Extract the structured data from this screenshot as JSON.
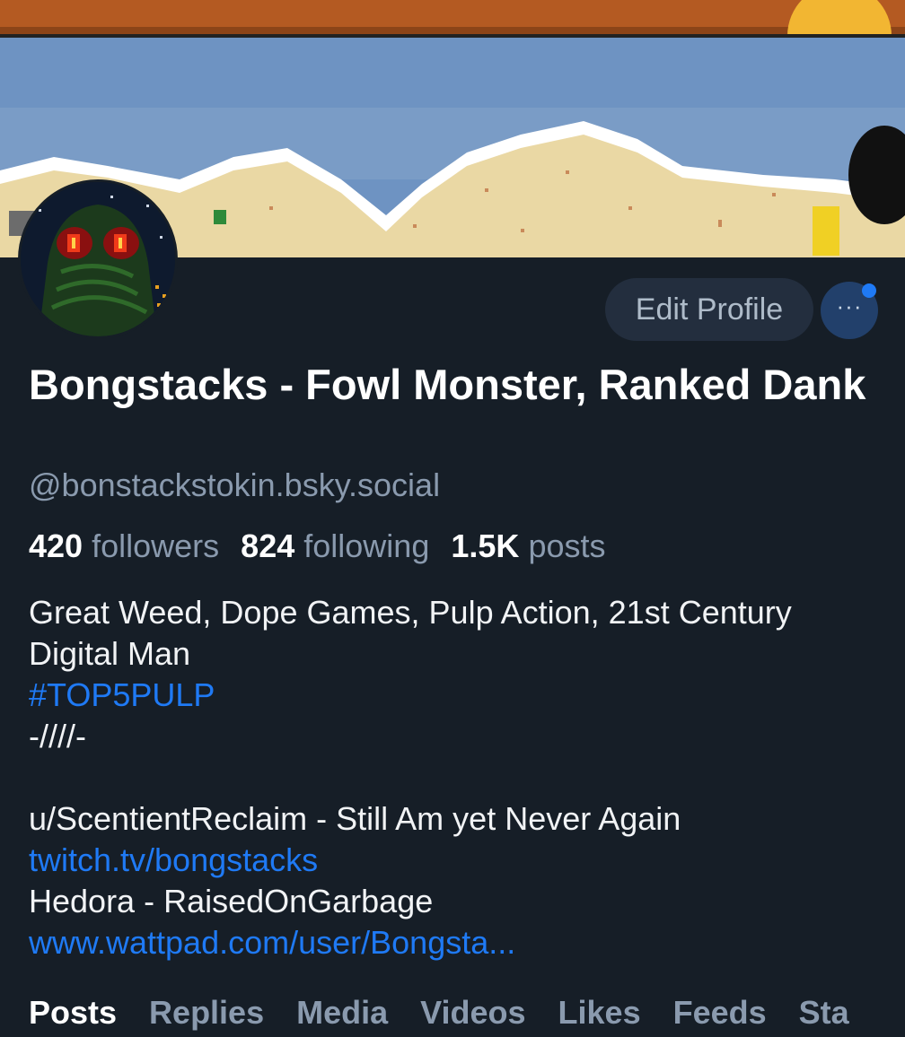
{
  "profile": {
    "display_name": "Bongstacks - Fowl Monster, Ranked Dank",
    "handle": "@bonstackstokin.bsky.social"
  },
  "actions": {
    "edit_profile_label": "Edit Profile",
    "more_label": "···"
  },
  "stats": {
    "followers_count": "420",
    "followers_label": "followers",
    "following_count": "824",
    "following_label": "following",
    "posts_count": "1.5K",
    "posts_label": "posts"
  },
  "bio": {
    "line1": "Great Weed, Dope Games, Pulp Action, 21st Century",
    "line2": "Digital Man",
    "hashtag": "#TOP5PULP",
    "line4": "-////-",
    "line6": "u/ScentientReclaim - Still Am yet Never Again",
    "link_twitch": "twitch.tv/bongstacks",
    "line8": "Hedora - RaisedOnGarbage",
    "link_wattpad": "www.wattpad.com/user/Bongsta..."
  },
  "tabs": [
    "Posts",
    "Replies",
    "Media",
    "Videos",
    "Likes",
    "Feeds",
    "Sta"
  ],
  "colors": {
    "background": "#161e27",
    "link": "#1f7af5",
    "muted_text": "#8a9aae",
    "button_bg": "#232e3e",
    "more_button_bg": "#22406b"
  },
  "icons": {
    "more": "ellipsis-icon",
    "notification": "notification-dot"
  }
}
